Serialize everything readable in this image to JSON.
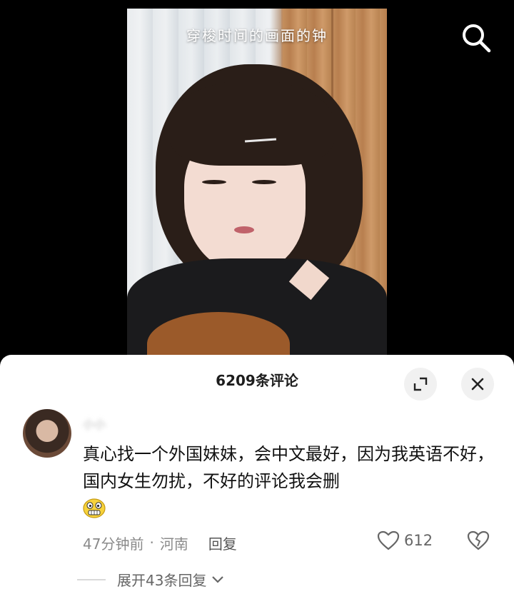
{
  "video": {
    "caption": "穿梭时间的画面的钟"
  },
  "comments_sheet": {
    "title": "6209条评论",
    "comment": {
      "username": "小小",
      "text": "真心找一个外国妹妹，会中文最好，因为我英语不好，国内女生勿扰，不好的评论我会删",
      "time": "47分钟前",
      "location": "河南",
      "separator": "·",
      "reply_label": "回复",
      "like_count": "612"
    },
    "expand_replies_label": "展开43条回复"
  },
  "icons": {
    "search": "search-icon",
    "expand": "expand-icon",
    "close": "close-icon",
    "like": "heart-icon",
    "dislike": "broken-heart-icon",
    "emoji": "grin-emoji-icon",
    "chevron": "chevron-down-icon"
  },
  "colors": {
    "sheet_bg": "#ffffff",
    "meta_text": "#8a8a8a",
    "primary_text": "#111111"
  }
}
